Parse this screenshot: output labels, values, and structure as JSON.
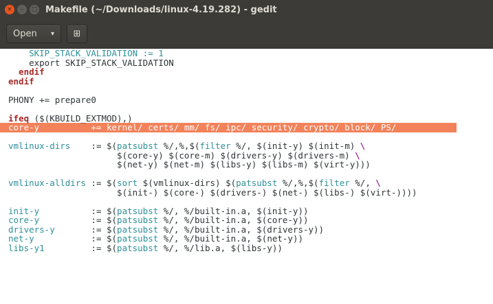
{
  "window": {
    "title": "Makefile (~/Downloads/linux-4.19.282) - gedit",
    "close_glyph": "×",
    "minimize_glyph": "–",
    "maximize_glyph": "□"
  },
  "toolbar": {
    "open_label": "Open",
    "open_chevron": "▾",
    "new_tab_glyph": "⊞"
  },
  "editor": {
    "highlight_color": "#f2825a",
    "lines": [
      {
        "segments": [
          {
            "t": "v",
            "s": "    SKIP_STACK_VALIDATION := 1"
          }
        ]
      },
      {
        "segments": [
          {
            "t": "plain",
            "s": "    export SKIP_STACK_VALIDATION"
          }
        ]
      },
      {
        "segments": [
          {
            "t": "kw",
            "s": "  endif"
          }
        ]
      },
      {
        "segments": [
          {
            "t": "kw",
            "s": "endif"
          }
        ]
      },
      {
        "segments": []
      },
      {
        "segments": [
          {
            "t": "plain",
            "s": "PHONY += prepare0"
          }
        ]
      },
      {
        "segments": []
      },
      {
        "segments": [
          {
            "t": "kw",
            "s": "ifeq"
          },
          {
            "t": "plain",
            "s": " ($(KBUILD_EXTMOD),)"
          }
        ]
      },
      {
        "highlight": true,
        "segments": [
          {
            "t": "plain",
            "s": "core-y          += kernel/ certs/ mm/ fs/ ipc/ security/ crypto/ block/ PS/"
          }
        ]
      },
      {
        "segments": []
      },
      {
        "segments": [
          {
            "t": "v",
            "s": "vmlinux-dirs"
          },
          {
            "t": "plain",
            "s": "    := $("
          },
          {
            "t": "fn",
            "s": "patsubst"
          },
          {
            "t": "plain",
            "s": " %/,%,$("
          },
          {
            "t": "fn",
            "s": "filter"
          },
          {
            "t": "plain",
            "s": " %/, $(init-y) $(init-m) "
          },
          {
            "t": "bs",
            "s": "\\"
          }
        ]
      },
      {
        "segments": [
          {
            "t": "plain",
            "s": "                     $(core-y) $(core-m) $(drivers-y) $(drivers-m) "
          },
          {
            "t": "bs",
            "s": "\\"
          }
        ]
      },
      {
        "segments": [
          {
            "t": "plain",
            "s": "                     $(net-y) $(net-m) $(libs-y) $(libs-m) $(virt-y)))"
          }
        ]
      },
      {
        "segments": []
      },
      {
        "segments": [
          {
            "t": "v",
            "s": "vmlinux-alldirs"
          },
          {
            "t": "plain",
            "s": " := $("
          },
          {
            "t": "fn",
            "s": "sort"
          },
          {
            "t": "plain",
            "s": " $(vmlinux-dirs) $("
          },
          {
            "t": "fn",
            "s": "patsubst"
          },
          {
            "t": "plain",
            "s": " %/,%,$("
          },
          {
            "t": "fn",
            "s": "filter"
          },
          {
            "t": "plain",
            "s": " %/, "
          },
          {
            "t": "bs",
            "s": "\\"
          }
        ]
      },
      {
        "segments": [
          {
            "t": "plain",
            "s": "                     $(init-) $(core-) $(drivers-) $(net-) $(libs-) $(virt-))))"
          }
        ]
      },
      {
        "segments": []
      },
      {
        "segments": [
          {
            "t": "v",
            "s": "init-y"
          },
          {
            "t": "plain",
            "s": "          := $("
          },
          {
            "t": "fn",
            "s": "patsubst"
          },
          {
            "t": "plain",
            "s": " %/, %/built-in.a, $(init-y))"
          }
        ]
      },
      {
        "segments": [
          {
            "t": "v",
            "s": "core-y"
          },
          {
            "t": "plain",
            "s": "          := $("
          },
          {
            "t": "fn",
            "s": "patsubst"
          },
          {
            "t": "plain",
            "s": " %/, %/built-in.a, $(core-y))"
          }
        ]
      },
      {
        "segments": [
          {
            "t": "v",
            "s": "drivers-y"
          },
          {
            "t": "plain",
            "s": "       := $("
          },
          {
            "t": "fn",
            "s": "patsubst"
          },
          {
            "t": "plain",
            "s": " %/, %/built-in.a, $(drivers-y))"
          }
        ]
      },
      {
        "segments": [
          {
            "t": "v",
            "s": "net-y"
          },
          {
            "t": "plain",
            "s": "           := $("
          },
          {
            "t": "fn",
            "s": "patsubst"
          },
          {
            "t": "plain",
            "s": " %/, %/built-in.a, $(net-y))"
          }
        ]
      },
      {
        "segments": [
          {
            "t": "v",
            "s": "libs-y1"
          },
          {
            "t": "plain",
            "s": "         := $("
          },
          {
            "t": "fn",
            "s": "patsubst"
          },
          {
            "t": "plain",
            "s": " %/, %/lib.a, $(libs-y))"
          }
        ]
      }
    ]
  }
}
